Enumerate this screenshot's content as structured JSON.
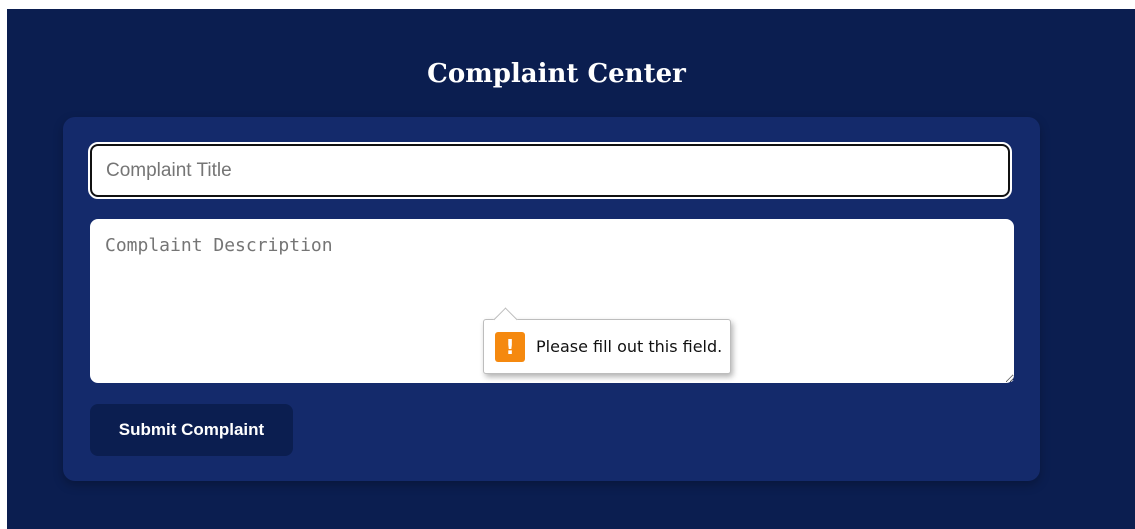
{
  "page": {
    "title": "Complaint Center"
  },
  "form": {
    "title_placeholder": "Complaint Title",
    "title_value": "",
    "description_placeholder": "Complaint Description",
    "description_value": "",
    "submit_label": "Submit Complaint"
  },
  "validation_tooltip": {
    "message": "Please fill out this field.",
    "icon": "warning-icon",
    "icon_glyph": "!"
  },
  "colors": {
    "background": "#0b1e50",
    "card": "#142a6b",
    "button": "#0b1e50",
    "warning": "#f5890f"
  }
}
